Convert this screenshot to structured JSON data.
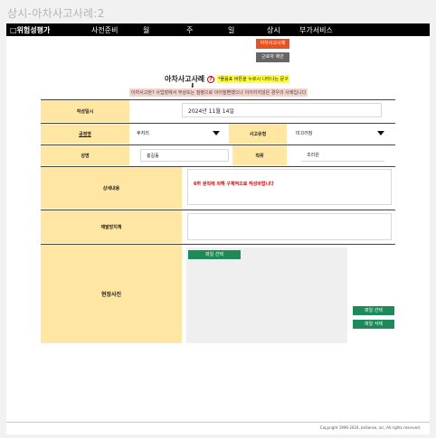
{
  "page_title": "상시-아차사고사례:2",
  "nav": {
    "brand": "□위험성평가",
    "items": [
      "사전준비",
      "월",
      "주",
      "일",
      "상시",
      "부가서비스"
    ]
  },
  "buttons": {
    "near_miss_case": "아차사고사례",
    "worker_suggestion": "근로자 제안"
  },
  "heading": {
    "title": "아차사고사례",
    "help_symbol": "?",
    "note": "*물음표 버튼을 누르시 나타나는 문구",
    "arrow": "⬇",
    "description": "아차사고란? 사업장에서 부상또는 질병으로 이어질뻔했으나 이어지지않은 경우의 사례입니다"
  },
  "form": {
    "date_label": "작성일시",
    "date_value": "2024년 11월 14일",
    "process_label": "공정명",
    "process_value": "후처리",
    "accident_type_label": "사고유형",
    "accident_type_value": "미끄러짐",
    "name_label": "성명",
    "name_value": "홍길동",
    "position_label": "직위",
    "position_value": "조리원",
    "detail_label": "상세내용",
    "detail_hint": "6하 원칙에 의해 구체적으로 작성바랍니다",
    "prevention_label": "재발방지책",
    "photo_label": "현장사진",
    "file_select": "파일 선택",
    "file_delete": "파일 삭제"
  },
  "footer": {
    "copyright": "Copyright 1996-2024, bnSense, inc, All rights reserved."
  }
}
